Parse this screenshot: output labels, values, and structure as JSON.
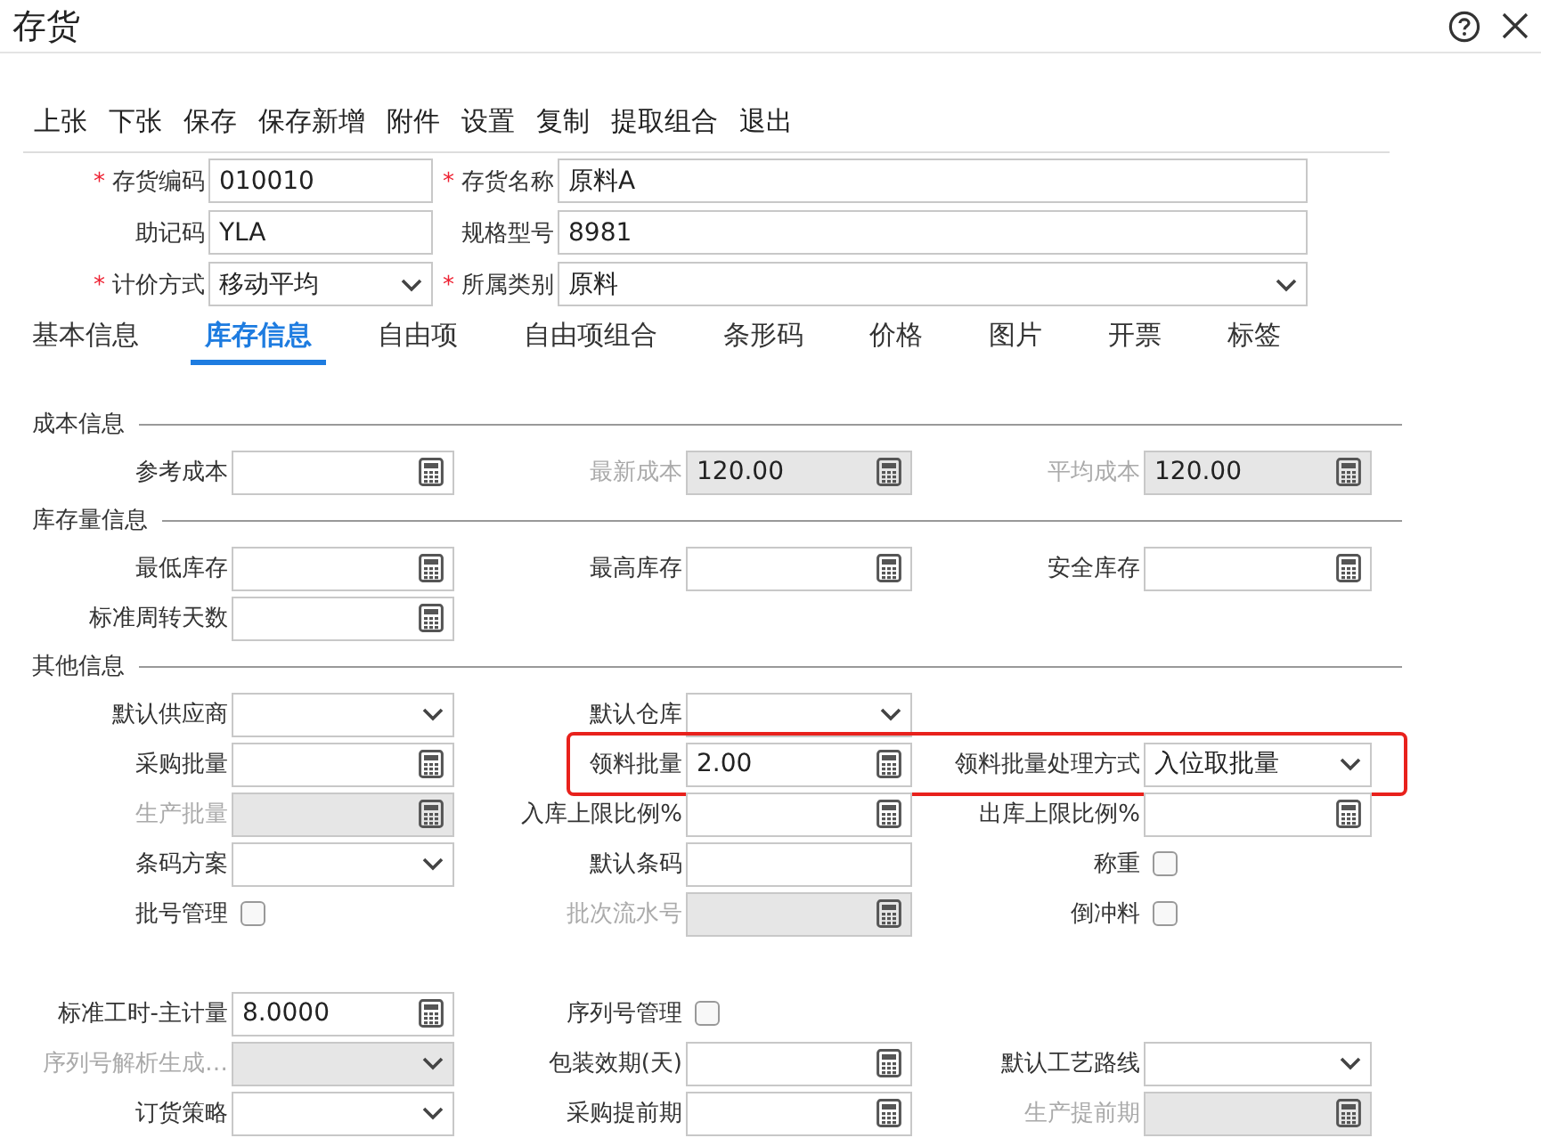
{
  "window": {
    "title": "存货"
  },
  "toolbar": [
    "上张",
    "下张",
    "保存",
    "保存新增",
    "附件",
    "设置",
    "复制",
    "提取组合",
    "退出"
  ],
  "header_fields": [
    {
      "marker": "*",
      "label": "存货编码",
      "kind": "text",
      "value": "010010"
    },
    {
      "marker": "*",
      "label": "存货名称",
      "kind": "text",
      "value": "原料A"
    },
    {
      "label": "助记码",
      "kind": "text",
      "value": "YLA"
    },
    {
      "label": "规格型号",
      "kind": "text",
      "value": "8981"
    },
    {
      "marker": "*",
      "label": "计价方式",
      "kind": "select",
      "value": "移动平均"
    },
    {
      "marker": "*",
      "label": "所属类别",
      "kind": "select",
      "value": "原料"
    }
  ],
  "tabs": [
    {
      "label": "基本信息",
      "selected": false
    },
    {
      "label": "库存信息",
      "selected": true
    },
    {
      "label": "自由项",
      "selected": false
    },
    {
      "label": "自由项组合",
      "selected": false
    },
    {
      "label": "条形码",
      "selected": false
    },
    {
      "label": "价格",
      "selected": false
    },
    {
      "label": "图片",
      "selected": false
    },
    {
      "label": "开票",
      "selected": false
    },
    {
      "label": "标签",
      "selected": false
    }
  ],
  "sections": [
    {
      "title": "成本信息",
      "groups": [
        [
          {
            "highlighted": false,
            "fields": [
              {
                "label": "参考成本",
                "kind": "calc",
                "disabled": false
              },
              {
                "label": "最新成本",
                "kind": "calc",
                "disabled": true,
                "value": "120.00"
              },
              {
                "label": "平均成本",
                "kind": "calc",
                "disabled": true,
                "value": "120.00"
              }
            ]
          }
        ]
      ]
    },
    {
      "title": "库存量信息",
      "groups": [
        [
          {
            "highlighted": false,
            "fields": [
              {
                "label": "最低库存",
                "kind": "calc",
                "disabled": false
              },
              {
                "label": "最高库存",
                "kind": "calc",
                "disabled": false
              },
              {
                "label": "安全库存",
                "kind": "calc",
                "disabled": false
              }
            ]
          },
          {
            "highlighted": false,
            "fields": [
              {
                "label": "标准周转天数",
                "kind": "calc",
                "disabled": false
              },
              {
                "kind": "blank"
              },
              {
                "kind": "blank"
              }
            ]
          }
        ]
      ]
    },
    {
      "title": "其他信息",
      "groups": [
        [
          {
            "highlighted": false,
            "fields": [
              {
                "label": "默认供应商",
                "kind": "select",
                "disabled": false
              },
              {
                "label": "默认仓库",
                "kind": "select",
                "disabled": false
              },
              {
                "kind": "blank"
              }
            ]
          },
          {
            "highlighted": true,
            "fields": [
              {
                "label": "采购批量",
                "kind": "calc",
                "disabled": false
              },
              {
                "label": "领料批量",
                "kind": "calc",
                "disabled": false,
                "value": "2.00"
              },
              {
                "label": "领料批量处理方式",
                "kind": "select",
                "disabled": false,
                "value": "入位取批量"
              }
            ]
          },
          {
            "highlighted": false,
            "fields": [
              {
                "label": "生产批量",
                "kind": "calc",
                "disabled": true
              },
              {
                "label": "入库上限比例%",
                "kind": "calc",
                "disabled": false
              },
              {
                "label": "出库上限比例%",
                "kind": "calc",
                "disabled": false
              }
            ]
          },
          {
            "highlighted": false,
            "fields": [
              {
                "label": "条码方案",
                "kind": "select",
                "disabled": false
              },
              {
                "label": "默认条码",
                "kind": "text",
                "disabled": false
              },
              {
                "label": "称重",
                "kind": "check",
                "checked": false
              }
            ]
          },
          {
            "highlighted": false,
            "fields": [
              {
                "label": "批号管理",
                "kind": "check",
                "checked": false
              },
              {
                "label": "批次流水号",
                "kind": "calc",
                "disabled": true
              },
              {
                "label": "倒冲料",
                "kind": "check",
                "checked": false
              }
            ]
          }
        ],
        [
          {
            "highlighted": false,
            "fields": [
              {
                "label": "标准工时-主计量",
                "kind": "calc",
                "disabled": false,
                "value": "8.0000"
              },
              {
                "label": "序列号管理",
                "kind": "check",
                "checked": false
              },
              {
                "kind": "blank"
              }
            ]
          },
          {
            "highlighted": false,
            "fields": [
              {
                "label": "序列号解析生成…",
                "kind": "select",
                "disabled": true
              },
              {
                "label": "包装效期(天)",
                "kind": "calc",
                "disabled": false
              },
              {
                "label": "默认工艺路线",
                "kind": "select",
                "disabled": false
              }
            ]
          },
          {
            "highlighted": false,
            "fields": [
              {
                "label": "订货策略",
                "kind": "select",
                "disabled": false
              },
              {
                "label": "采购提前期",
                "kind": "calc",
                "disabled": false
              },
              {
                "label": "生产提前期",
                "kind": "calc",
                "disabled": true
              }
            ]
          }
        ]
      ]
    }
  ]
}
